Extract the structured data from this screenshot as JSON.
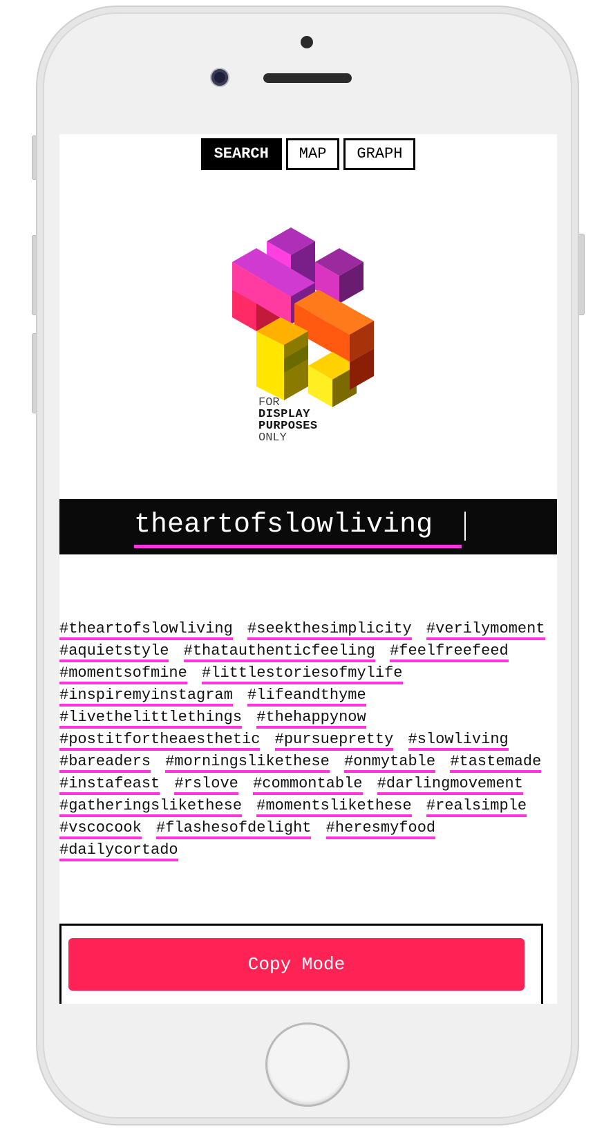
{
  "nav": {
    "tabs": [
      {
        "label": "SEARCH",
        "active": true
      },
      {
        "label": "MAP",
        "active": false
      },
      {
        "label": "GRAPH",
        "active": false
      }
    ]
  },
  "logo": {
    "line1": "FOR",
    "line2": "DISPLAY",
    "line3": "PURPOSES",
    "line4": "ONLY"
  },
  "search": {
    "value": "theartofslowliving"
  },
  "hashtags": [
    "#theartofslowliving",
    "#seekthesimplicity",
    "#verilymoment",
    "#aquietstyle",
    "#thatauthenticfeeling",
    "#feelfreefeed",
    "#momentsofmine",
    "#littlestoriesofmylife",
    "#inspiremyinstagram",
    "#lifeandthyme",
    "#livethelittlethings",
    "#thehappynow",
    "#postitfortheaesthetic",
    "#pursuepretty",
    "#slowliving",
    "#bareaders",
    "#morningslikethese",
    "#onmytable",
    "#tastemade",
    "#instafeast",
    "#rslove",
    "#commontable",
    "#darlingmovement",
    "#gatheringslikethese",
    "#momentslikethese",
    "#realsimple",
    "#vscocook",
    "#flashesofdelight",
    "#heresmyfood",
    "#dailycortado"
  ],
  "copy_mode": {
    "label": "Copy Mode"
  },
  "colors": {
    "accent_underline": "#ff33e0",
    "button": "#ff2255",
    "search_bg": "#0a0a0a"
  },
  "icons": {
    "logo": "cube-cluster-logo"
  }
}
